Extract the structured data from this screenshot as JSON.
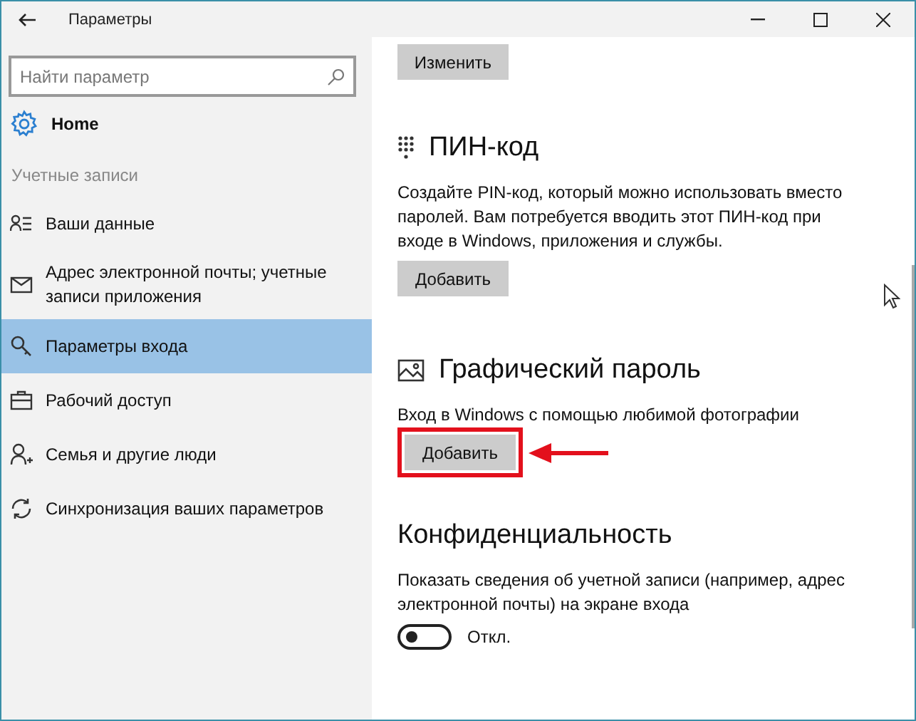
{
  "window": {
    "title": "Параметры"
  },
  "sidebar": {
    "search": {
      "placeholder": "Найти параметр"
    },
    "home": "Home",
    "group_heading": "Учетные записи",
    "items": [
      {
        "label": "Ваши данные",
        "selected": false
      },
      {
        "label": "Адрес электронной почты; учетные записи приложения",
        "selected": false
      },
      {
        "label": "Параметры входа",
        "selected": true
      },
      {
        "label": "Рабочий доступ",
        "selected": false
      },
      {
        "label": "Семья и другие люди",
        "selected": false
      },
      {
        "label": "Синхронизация ваших параметров",
        "selected": false
      }
    ]
  },
  "content": {
    "sections": [
      {
        "kind": "button",
        "button": "Изменить",
        "highlighted": false
      },
      {
        "kind": "setting",
        "title": "ПИН-код",
        "description": "Создайте PIN-код, который можно использовать вместо паролей. Вам потребуется вводить этот ПИН-код при входе в Windows, приложения и службы.",
        "button": "Добавить",
        "highlighted": false
      },
      {
        "kind": "setting",
        "title": "Графический пароль",
        "description": "Вход в Windows с помощью любимой фотографии",
        "button": "Добавить",
        "highlighted": true
      },
      {
        "kind": "toggle",
        "title": "Конфиденциальность",
        "description": "Показать сведения об учетной записи (например, адрес электронной почты) на экране входа",
        "toggle": {
          "on": false,
          "label": "Откл."
        }
      }
    ]
  }
}
